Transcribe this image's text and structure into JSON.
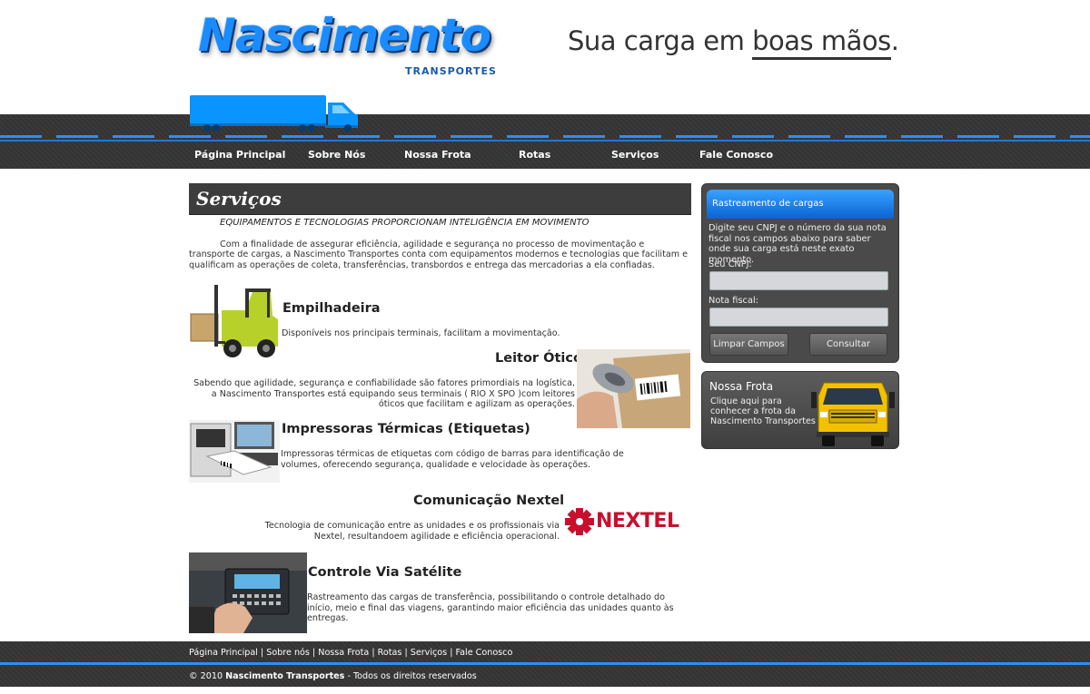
{
  "header": {
    "logo_word": "Nascimento",
    "logo_sub": "TRANSPORTES",
    "slogan_prefix": "Sua carga em ",
    "slogan_emphasis": "boas mãos",
    "slogan_suffix": "."
  },
  "nav": [
    {
      "label": "Página Principal"
    },
    {
      "label": "Sobre Nós"
    },
    {
      "label": "Nossa Frota"
    },
    {
      "label": "Rotas"
    },
    {
      "label": "Serviços"
    },
    {
      "label": "Fale Conosco"
    }
  ],
  "main": {
    "title": "Serviços",
    "tagline": "EQUIPAMENTOS E TECNOLOGIAS PROPORCIONAM INTELIGÊNCIA EM MOVIMENTO",
    "intro": "Com a finalidade de assegurar eficiência, agilidade e segurança no processo de movimentação e transporte de cargas, a Nascimento Transportes conta com equipamentos modernos e  tecnologias que facilitam e qualificam as operações de coleta, transferências, transbordos e entrega das mercadorias a ela confiadas.",
    "services": [
      {
        "title": "Empilhadeira",
        "text": "Disponíveis nos principais terminais,  facilitam a movimentação."
      },
      {
        "title": "Leitor Ótico",
        "text": "Sabendo que agilidade, segurança e confiabilidade são fatores primordiais na logística, a Nascimento Transportes está equipando seus terminais ( RIO X SPO )com leitores óticos que facilitam e agilizam as operações."
      },
      {
        "title": "Impressoras Térmicas (Etiquetas)",
        "text": "Impressoras térmicas de etiquetas com código de barras para identificação de  volumes, oferecendo segurança, qualidade e velocidade às operações."
      },
      {
        "title": "Comunicação Nextel",
        "text": "Tecnologia de comunicação entre as unidades e os profissionais via Nextel, resultandoem agilidade e eficiência operacional.",
        "logo": "NEXTEL"
      },
      {
        "title": "Controle Via Satélite",
        "text": "Rastreamento das cargas de transferência, possibilitando o controle detalhado do início, meio e final das viagens, garantindo maior eficiência das unidades quanto às entregas."
      }
    ]
  },
  "sidebar": {
    "tracking": {
      "title": "Rastreamento de cargas",
      "description": "Digite seu CNPJ e o número da sua nota fiscal nos campos abaixo para saber onde sua carga está neste exato momento.",
      "cnpj_label": "Seu CNPJ:",
      "cnpj_value": "",
      "nota_label": "Nota fiscal:",
      "nota_value": "",
      "clear_button": "Limpar Campos",
      "submit_button": "Consultar"
    },
    "frota": {
      "title": "Nossa Frota",
      "text": "Clique aqui para conhecer a frota da Nascimento Transportes"
    }
  },
  "footer": {
    "links": [
      "Página Principal",
      "Sobre nós",
      "Nossa Frota",
      "Rotas",
      "Serviços",
      "Fale Conosco"
    ],
    "separator": " | ",
    "copy_prefix": "© 2010 ",
    "copy_company": "Nascimento Transportes",
    "copy_suffix": " - Todos os direitos reservados"
  },
  "colors": {
    "brand_blue": "#1a8cff",
    "road_dark": "#363636",
    "accent_line": "#2f8ef0"
  }
}
